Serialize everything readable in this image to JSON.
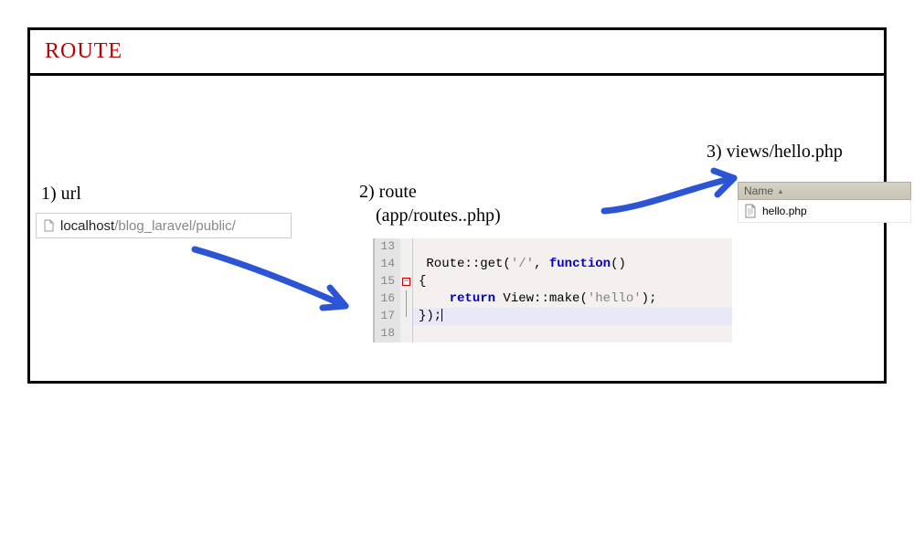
{
  "title": "ROUTE",
  "section1": {
    "label": "1) url",
    "host": "localhost",
    "path": "/blog_laravel/public/"
  },
  "section2": {
    "label_line1": "2) route",
    "label_line2": "(app/routes..php)",
    "lines": [
      "13",
      "14",
      "15",
      "16",
      "17",
      "18"
    ],
    "code": {
      "l14_a": "Route",
      "l14_b": "::get(",
      "l14_c": "'/'",
      "l14_d": ", ",
      "l14_e": "function",
      "l14_f": "()",
      "l15": "{",
      "l16_a": "    ",
      "l16_b": "return",
      "l16_c": " View::make(",
      "l16_d": "'hello'",
      "l16_e": ");",
      "l17": "});"
    }
  },
  "section3": {
    "label": "3) views/hello.php",
    "column_header": "Name",
    "file": "hello.php"
  },
  "arrow_color": "#2b55d4"
}
